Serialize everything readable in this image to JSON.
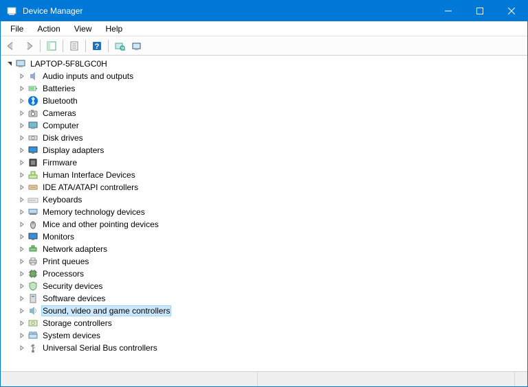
{
  "window": {
    "title": "Device Manager"
  },
  "menu": {
    "file": "File",
    "action": "Action",
    "view": "View",
    "help": "Help"
  },
  "tree": {
    "root": "LAPTOP-5F8LGC0H",
    "nodes": [
      {
        "label": "Audio inputs and outputs",
        "icon": "audio"
      },
      {
        "label": "Batteries",
        "icon": "battery"
      },
      {
        "label": "Bluetooth",
        "icon": "bluetooth"
      },
      {
        "label": "Cameras",
        "icon": "camera"
      },
      {
        "label": "Computer",
        "icon": "computer"
      },
      {
        "label": "Disk drives",
        "icon": "disk"
      },
      {
        "label": "Display adapters",
        "icon": "display"
      },
      {
        "label": "Firmware",
        "icon": "firmware"
      },
      {
        "label": "Human Interface Devices",
        "icon": "hid"
      },
      {
        "label": "IDE ATA/ATAPI controllers",
        "icon": "ide"
      },
      {
        "label": "Keyboards",
        "icon": "keyboard"
      },
      {
        "label": "Memory technology devices",
        "icon": "memory"
      },
      {
        "label": "Mice and other pointing devices",
        "icon": "mouse"
      },
      {
        "label": "Monitors",
        "icon": "monitor"
      },
      {
        "label": "Network adapters",
        "icon": "network"
      },
      {
        "label": "Print queues",
        "icon": "print"
      },
      {
        "label": "Processors",
        "icon": "cpu"
      },
      {
        "label": "Security devices",
        "icon": "security"
      },
      {
        "label": "Software devices",
        "icon": "software"
      },
      {
        "label": "Sound, video and game controllers",
        "icon": "sound",
        "selected": true
      },
      {
        "label": "Storage controllers",
        "icon": "storage"
      },
      {
        "label": "System devices",
        "icon": "system"
      },
      {
        "label": "Universal Serial Bus controllers",
        "icon": "usb"
      }
    ]
  }
}
